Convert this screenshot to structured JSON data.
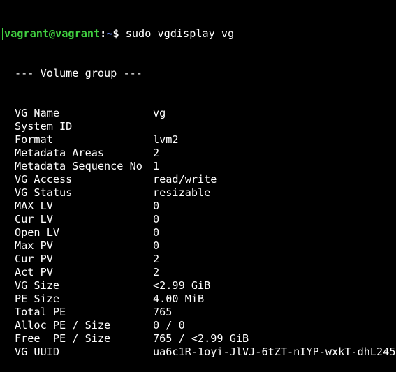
{
  "prompt": {
    "user_host": "vagrant@vagrant",
    "colon": ":",
    "path": "~",
    "dollar": "$",
    "command": " sudo vgdisplay vg"
  },
  "header": "--- Volume group ---",
  "rows": [
    {
      "key": "VG Name",
      "value": "vg"
    },
    {
      "key": "System ID",
      "value": ""
    },
    {
      "key": "Format",
      "value": "lvm2"
    },
    {
      "key": "Metadata Areas",
      "value": "2"
    },
    {
      "key": "Metadata Sequence No",
      "value": "1"
    },
    {
      "key": "VG Access",
      "value": "read/write"
    },
    {
      "key": "VG Status",
      "value": "resizable"
    },
    {
      "key": "MAX LV",
      "value": "0"
    },
    {
      "key": "Cur LV",
      "value": "0"
    },
    {
      "key": "Open LV",
      "value": "0"
    },
    {
      "key": "Max PV",
      "value": "0"
    },
    {
      "key": "Cur PV",
      "value": "2"
    },
    {
      "key": "Act PV",
      "value": "2"
    },
    {
      "key": "VG Size",
      "value": "<2.99 GiB"
    },
    {
      "key": "PE Size",
      "value": "4.00 MiB"
    },
    {
      "key": "Total PE",
      "value": "765"
    },
    {
      "key": "Alloc PE / Size",
      "value": "0 / 0"
    },
    {
      "key": "Free  PE / Size",
      "value": "765 / <2.99 GiB"
    },
    {
      "key": "VG UUID",
      "value": "ua6c1R-1oyi-JlVJ-6tZT-nIYP-wxkT-dhL245"
    }
  ],
  "colors": {
    "background": "#000000",
    "text": "#ffffff",
    "user_host": "#41d041",
    "path": "#6b8cff"
  }
}
